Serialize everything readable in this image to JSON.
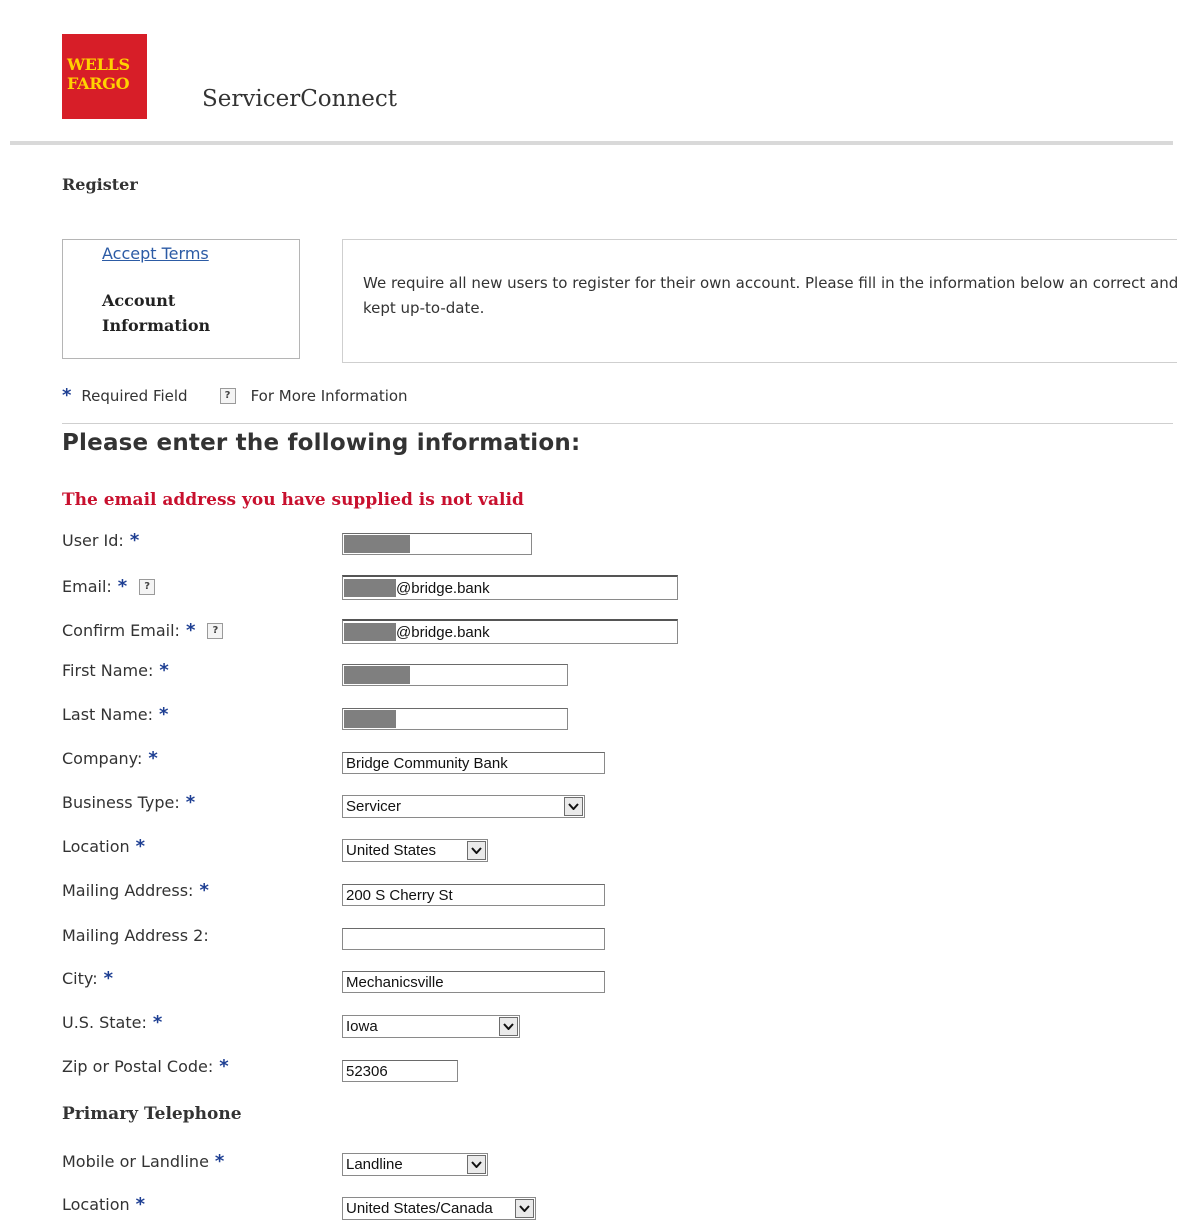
{
  "header": {
    "logo_line1": "WELLS",
    "logo_line2": "FARGO",
    "app_title": "ServicerConnect"
  },
  "breadcrumb": "Register",
  "steps": {
    "accept_terms": "Accept Terms",
    "account_information": "Account Information"
  },
  "intro": "We require all new users to register for their own account. Please fill in the information below an correct and kept up-to-date.",
  "legend": {
    "required_star": "*",
    "required_label": "Required Field",
    "help_glyph": "?",
    "help_label": "For More Information"
  },
  "section_title": "Please enter the following information:",
  "error_message": "The email address you have supplied is not valid",
  "form": {
    "user_id_label": "User Id:",
    "email_label": "Email:",
    "email_value": "@bridge.bank",
    "confirm_email_label": "Confirm Email:",
    "confirm_email_value": "@bridge.bank",
    "first_name_label": "First Name:",
    "last_name_label": "Last Name:",
    "company_label": "Company:",
    "company_value": "Bridge Community Bank",
    "business_type_label": "Business Type:",
    "business_type_value": "Servicer",
    "location_label": "Location",
    "location_value": "United States",
    "mailing_address_label": "Mailing Address:",
    "mailing_address_value": "200 S Cherry St",
    "mailing_address2_label": "Mailing Address 2:",
    "mailing_address2_value": "",
    "city_label": "City:",
    "city_value": "Mechanicsville",
    "state_label": "U.S. State:",
    "state_value": "Iowa",
    "zip_label": "Zip or Postal Code:",
    "zip_value": "52306"
  },
  "telephone": {
    "heading": "Primary Telephone",
    "type_label": "Mobile or Landline",
    "type_value": "Landline",
    "location_label": "Location",
    "location_value": "United States/Canada"
  },
  "icons": {
    "required": "star-icon",
    "help": "help-icon",
    "dropdown": "chevron-down-icon"
  },
  "colors": {
    "brand_red": "#d71e28",
    "brand_gold": "#ffd200",
    "error_red": "#c8102e",
    "required_blue": "#1e3f93",
    "link_blue": "#2c5ba5"
  }
}
